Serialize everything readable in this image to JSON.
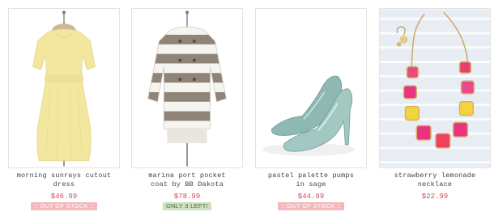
{
  "products": [
    {
      "name_line1": "morning sunrays cutout",
      "name_line2": "dress",
      "price": "$46.99",
      "badge": ":: OUT OF STOCK ::",
      "badge_type": "out",
      "image_icon": "yellow-dress-image"
    },
    {
      "name_line1": "marina port pocket",
      "name_line2": "coat by BB Dakota",
      "price": "$78.99",
      "badge": "ONLY 3 LEFT!",
      "badge_type": "left",
      "image_icon": "striped-coat-image"
    },
    {
      "name_line1": "pastel palette pumps",
      "name_line2": "in sage",
      "price": "$44.99",
      "badge": ":: OUT OF STOCK ::",
      "badge_type": "out",
      "image_icon": "sage-pumps-image"
    },
    {
      "name_line1": "strawberry lemonade",
      "name_line2": "necklace",
      "price": "$22.99",
      "badge": "",
      "badge_type": "none",
      "image_icon": "necklace-image"
    }
  ],
  "colors": {
    "price": "#d64a56",
    "out_of_stock_badge": "#f3b7bc",
    "low_stock_badge": "#cde0c2"
  }
}
